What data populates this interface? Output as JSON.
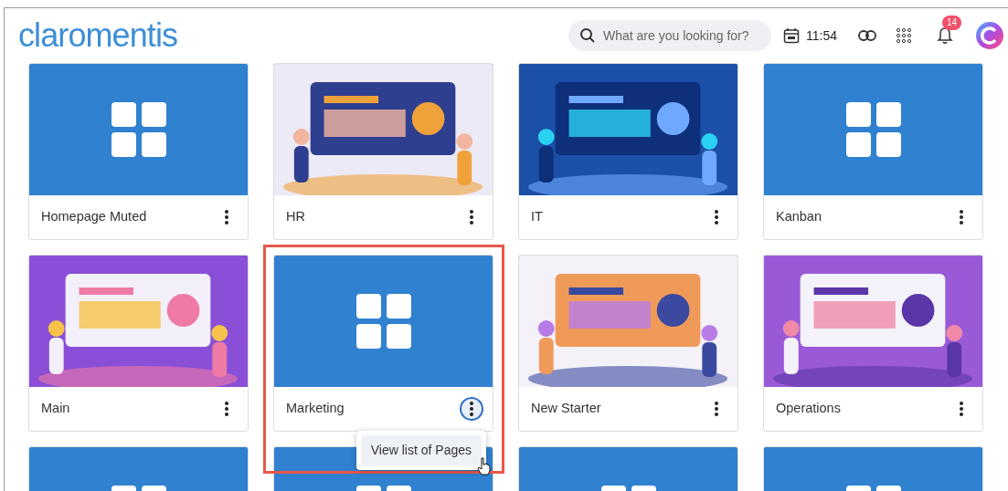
{
  "header": {
    "logo": "claromentis",
    "search": {
      "placeholder": "What are you looking for?"
    },
    "time": "11:54",
    "notifications": "14"
  },
  "cards": [
    {
      "kind": "tile",
      "title": "Homepage Muted",
      "highlighted": false,
      "menu_open": false
    },
    {
      "kind": "picture",
      "title": "HR",
      "highlighted": false,
      "menu_open": false
    },
    {
      "kind": "picture",
      "title": "IT",
      "highlighted": false,
      "menu_open": false
    },
    {
      "kind": "tile",
      "title": "Kanban",
      "highlighted": false,
      "menu_open": false
    },
    {
      "kind": "picture",
      "title": "Main",
      "highlighted": false,
      "menu_open": false
    },
    {
      "kind": "tile",
      "title": "Marketing",
      "highlighted": true,
      "menu_open": true,
      "menu": [
        {
          "label": "View list of Pages",
          "selected": true
        }
      ]
    },
    {
      "kind": "picture",
      "title": "New Starter",
      "highlighted": false,
      "menu_open": false
    },
    {
      "kind": "picture",
      "title": "Operations",
      "highlighted": false,
      "menu_open": false
    },
    {
      "kind": "tile"
    },
    {
      "kind": "tile"
    },
    {
      "kind": "tile"
    },
    {
      "kind": "tile"
    }
  ]
}
